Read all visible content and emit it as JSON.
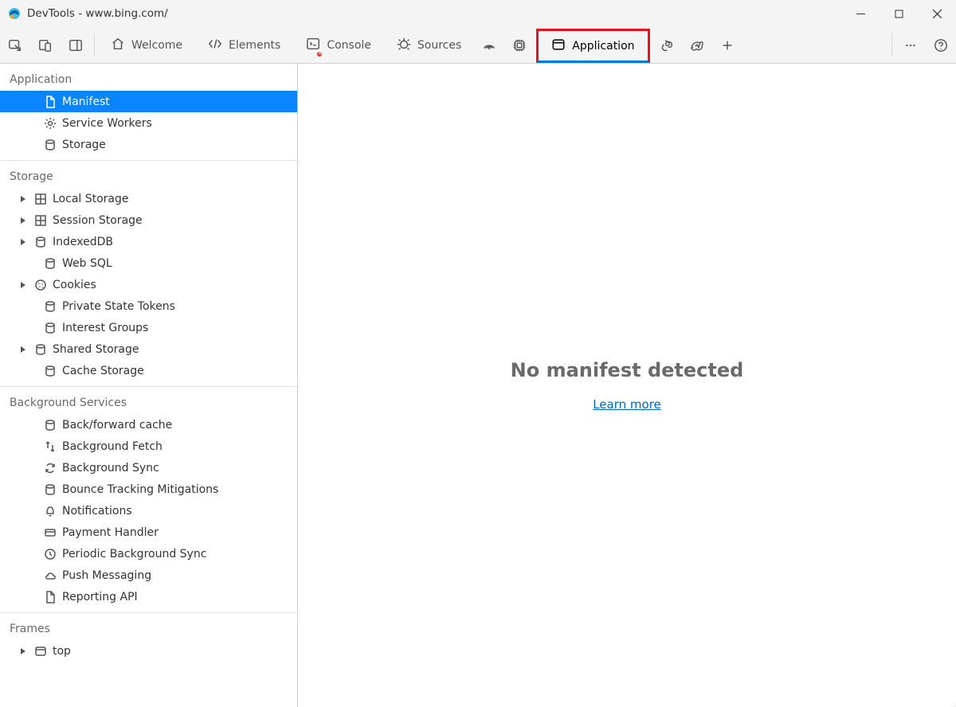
{
  "window": {
    "title": "DevTools - www.bing.com/"
  },
  "toolbar": {
    "tabs": {
      "welcome": "Welcome",
      "elements": "Elements",
      "console": "Console",
      "sources": "Sources",
      "application": "Application"
    }
  },
  "sidebar": {
    "sections": {
      "application": {
        "header": "Application",
        "items": {
          "manifest": "Manifest",
          "service_workers": "Service Workers",
          "storage": "Storage"
        }
      },
      "storage": {
        "header": "Storage",
        "items": {
          "local_storage": "Local Storage",
          "session_storage": "Session Storage",
          "indexeddb": "IndexedDB",
          "web_sql": "Web SQL",
          "cookies": "Cookies",
          "private_state_tokens": "Private State Tokens",
          "interest_groups": "Interest Groups",
          "shared_storage": "Shared Storage",
          "cache_storage": "Cache Storage"
        }
      },
      "background_services": {
        "header": "Background Services",
        "items": {
          "back_forward_cache": "Back/forward cache",
          "background_fetch": "Background Fetch",
          "background_sync": "Background Sync",
          "bounce_tracking": "Bounce Tracking Mitigations",
          "notifications": "Notifications",
          "payment_handler": "Payment Handler",
          "periodic_bg_sync": "Periodic Background Sync",
          "push_messaging": "Push Messaging",
          "reporting_api": "Reporting API"
        }
      },
      "frames": {
        "header": "Frames",
        "items": {
          "top": "top"
        }
      }
    }
  },
  "main": {
    "empty_message": "No manifest detected",
    "learn_more": "Learn more"
  }
}
